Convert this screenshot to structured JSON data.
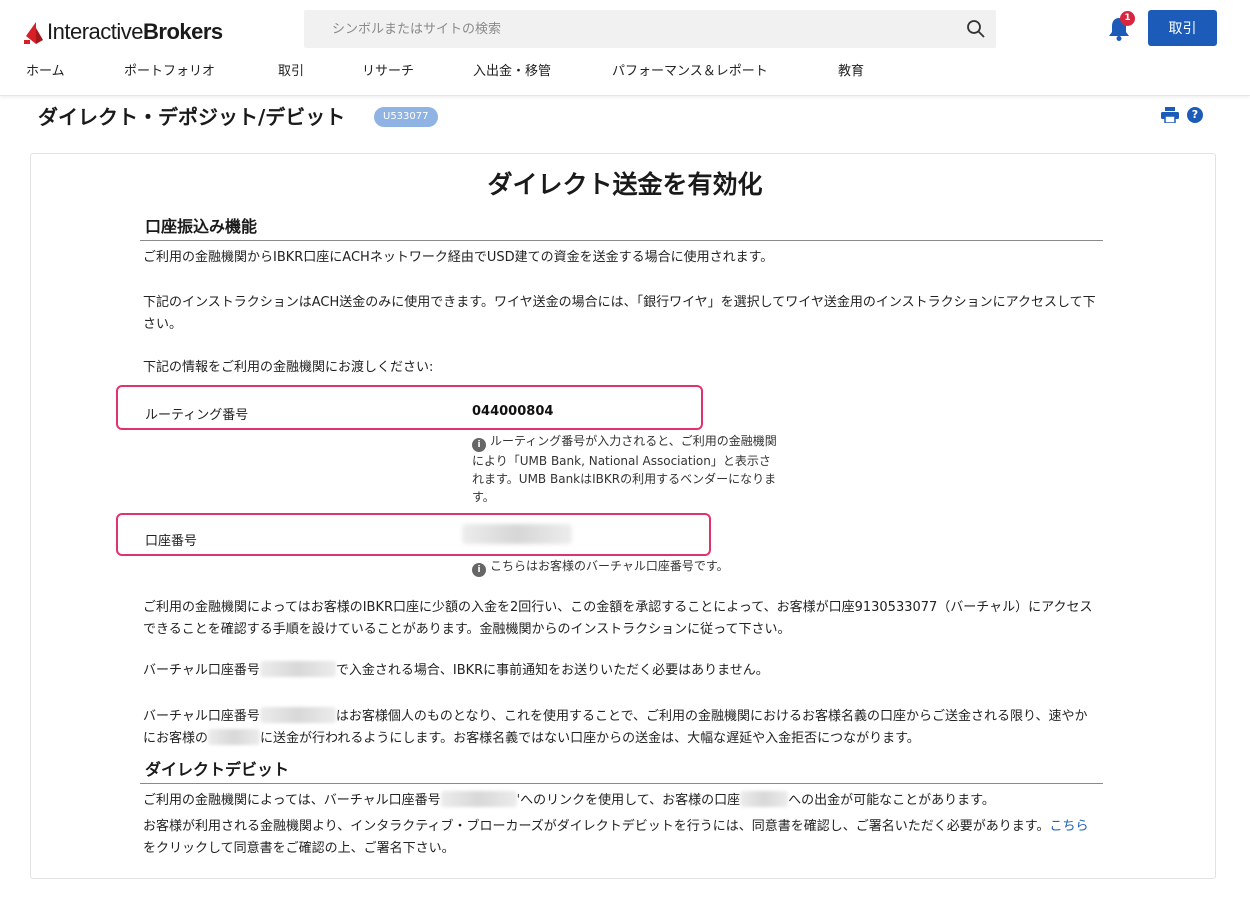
{
  "header": {
    "logo_text_light": "Interactive",
    "logo_text_bold": "Brokers",
    "search_placeholder": "シンボルまたはサイトの検索",
    "notification_count": "1",
    "trade_button": "取引"
  },
  "nav": {
    "items": [
      "ホーム",
      "ポートフォリオ",
      "取引",
      "リサーチ",
      "入出金・移管",
      "パフォーマンス＆レポート",
      "教育"
    ]
  },
  "page": {
    "title": "ダイレクト・デポジット/デビット",
    "account_badge": "U533077"
  },
  "content": {
    "main_title": "ダイレクト送金を有効化",
    "section1_heading": "口座振込み機能",
    "p1": "ご利用の金融機関からIBKR口座にACHネットワーク経由でUSD建ての資金を送金する場合に使用されます。",
    "p2": "下記のインストラクションはACH送金のみに使用できます。ワイヤ送金の場合には、「銀行ワイヤ」を選択してワイヤ送金用のインストラクションにアクセスして下さい。",
    "p3": "下記の情報をご利用の金融機関にお渡しください:",
    "routing_label": "ルーティング番号",
    "routing_value": "044000804",
    "routing_info": "ルーティング番号が入力されると、ご利用の金融機関により「UMB Bank, National Association」と表示されます。UMB BankはIBKRの利用するベンダーになります。",
    "account_label": "口座番号",
    "account_info": "こちらはお客様のバーチャル口座番号です。",
    "p4": "ご利用の金融機関によってはお客様のIBKR口座に少額の入金を2回行い、この金額を承認することによって、お客様が口座9130533077（バーチャル）にアクセスできることを確認する手順を設けていることがあります。金融機関からのインストラクションに従って下さい。",
    "p5_a": "バーチャル口座番号",
    "p5_b": "で入金される場合、IBKRに事前通知をお送りいただく必要はありません。",
    "p6_a": "バーチャル口座番号",
    "p6_b": "はお客様個人のものとなり、これを使用することで、ご利用の金融機関におけるお客様名義の口座からご送金される限り、速やかにお客様の",
    "p6_c": "に送金が行われるようにします。お客様名義ではない口座からの送金は、大幅な遅延や入金拒否につながります。",
    "section2_heading": "ダイレクトデビット",
    "p7_a": "ご利用の金融機関によっては、バーチャル口座番号",
    "p7_b": "'へのリンクを使用して、お客様の口座",
    "p7_c": "への出金が可能なことがあります。",
    "p8_a": "お客様が利用される金融機関より、インタラクティブ・ブローカーズがダイレクトデビットを行うには、同意書を確認し、ご署名いただく必要があります。",
    "p8_link": "こちら",
    "p8_b": "をクリックして同意書をご確認の上、ご署名下さい。"
  },
  "colors": {
    "brand_blue": "#1c5cb8",
    "highlight_pink": "#e0336e",
    "logo_red": "#d81f26"
  }
}
